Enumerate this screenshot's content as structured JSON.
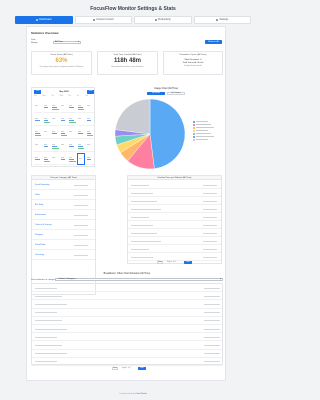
{
  "title": "FocusFlow Monitor Settings & Stats",
  "tabs": [
    {
      "label": "Dashboard",
      "active": true
    },
    {
      "label": "Content Control",
      "active": false
    },
    {
      "label": "Productivity",
      "active": false
    },
    {
      "label": "Settings",
      "active": false
    }
  ],
  "stats": {
    "heading": "Statistics Overview",
    "range_label": "Date Range:",
    "range_value": "All Time",
    "refresh_label": "Refresh All"
  },
  "cards": [
    {
      "title": "Focus Score (All Time)",
      "value": "63%",
      "note": "Percentage of time spent on categories marked as Productive",
      "color": "#f0ad1c"
    },
    {
      "title": "Total Time Tracked (All Time)",
      "value": "118h 48m",
      "note": "Accumulated tracked time across all domains",
      "color": "#222"
    },
    {
      "title": "Pomodoro Cycles (All Time)",
      "value": "Work Sessions: 0",
      "value2": "Total Focused: 0h 0m",
      "note": "Completed work intervals",
      "color": "#222"
    }
  ],
  "calendar": {
    "month": "May 2025",
    "prev_label": "Prev",
    "next_label": "Next",
    "weekdays": [
      "Sun",
      "Mon",
      "Tue",
      "Wed",
      "Thu",
      "Fri",
      "Sat"
    ]
  },
  "usage_chart": {
    "title": "Usage Chart (All Time)",
    "toggle_domains": "By Domain",
    "toggle_categories": "By Category"
  },
  "chart_data": {
    "type": "pie",
    "title": "Usage Chart (All Time)",
    "slices": [
      {
        "label": "",
        "value": 48,
        "color": "#5aa9f5"
      },
      {
        "label": "",
        "value": 13,
        "color": "#ff7fa1"
      },
      {
        "label": "",
        "value": 5,
        "color": "#ffb86b"
      },
      {
        "label": "",
        "value": 4,
        "color": "#ffd96b"
      },
      {
        "label": "",
        "value": 4,
        "color": "#6fd0c4"
      },
      {
        "label": "",
        "value": 3,
        "color": "#9b8cf2"
      },
      {
        "label": "",
        "value": 23,
        "color": "#c9ccd2"
      }
    ],
    "legend_position": "right"
  },
  "category_table": {
    "title": "Time per Category (All Time)",
    "rows": [
      "Social Networking",
      "Video",
      "AI & Utility",
      "Entertainment",
      "Technical & Learning",
      "Shopping",
      "Social Media",
      "Technology"
    ]
  },
  "website_table": {
    "title": "Detailed Time per Website (All Time)",
    "page_label": "Page 1 of 4",
    "prev_label": "Prev",
    "next_label": "Next"
  },
  "breakdown": {
    "title": "Breakdown: Other Chart Domains (All Time)",
    "filter_label": "View websites in category:",
    "filter_value": "-- Select Category --",
    "page_label": "Page 1 of 2",
    "prev_label": "Prev",
    "next_label": "Next"
  },
  "footer": {
    "prefix": "Created with",
    "heart": "♥",
    "middle": "by",
    "link": "Cloud Studio"
  }
}
